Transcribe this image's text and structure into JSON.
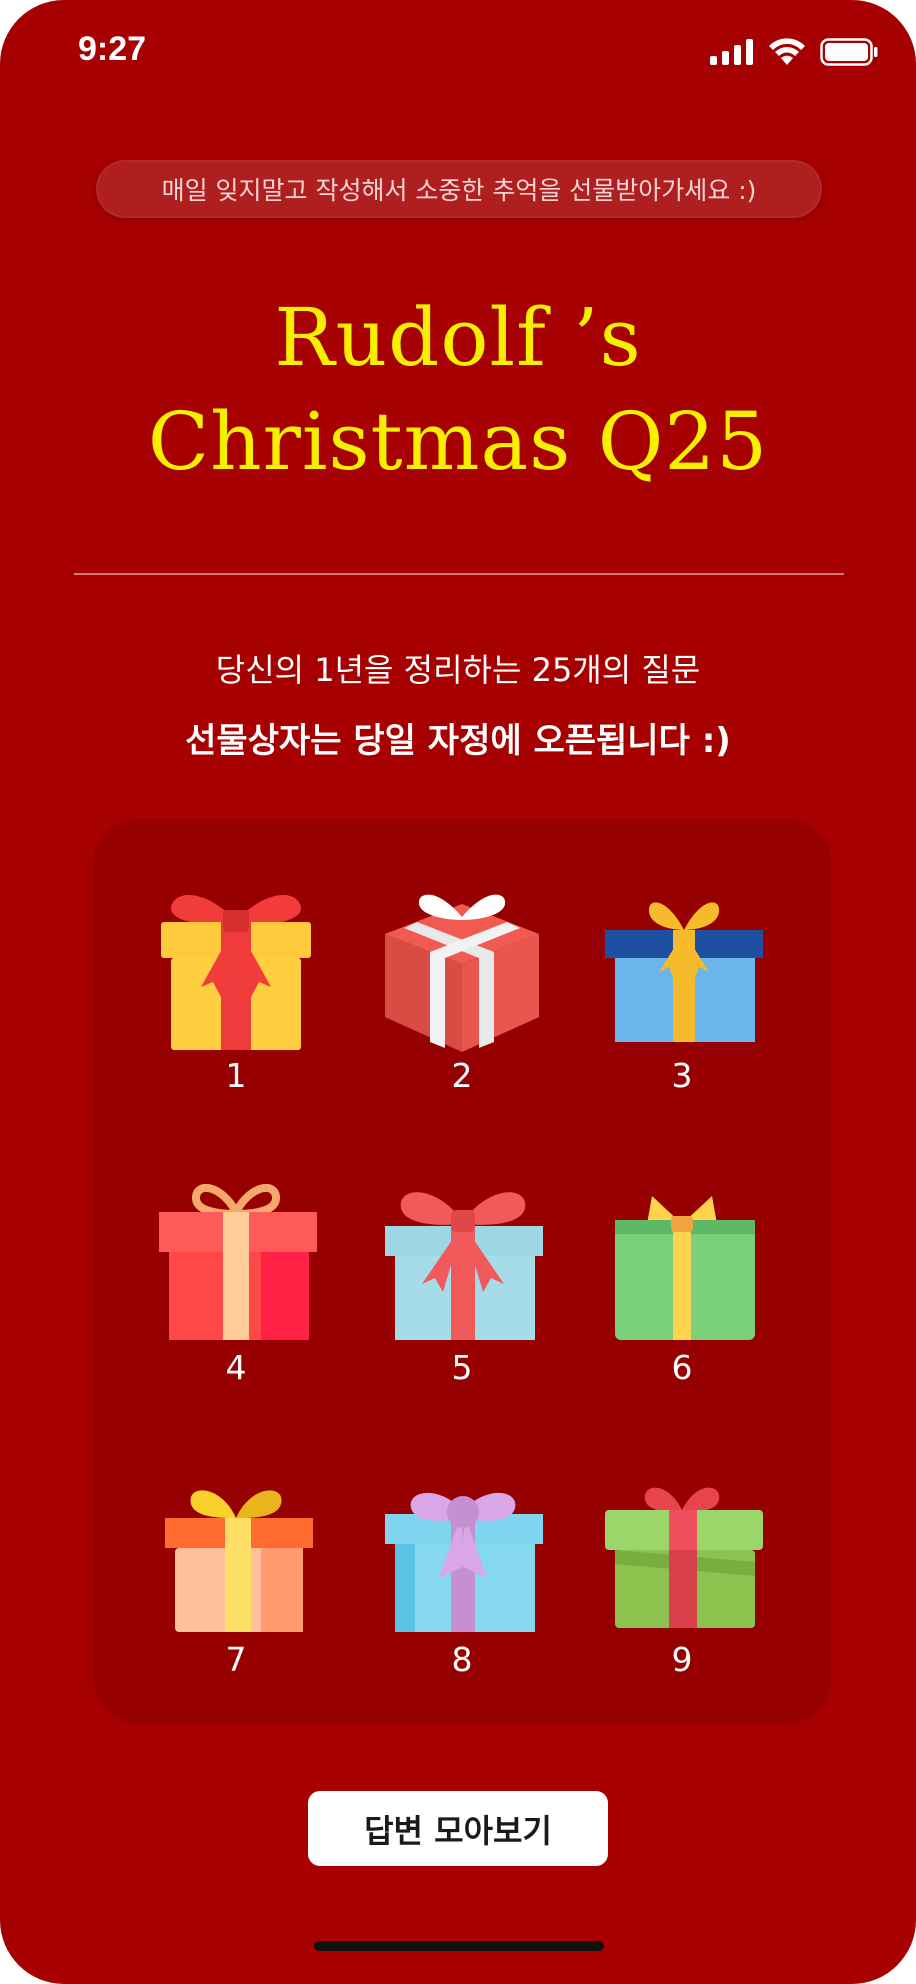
{
  "status_bar": {
    "time": "9:27"
  },
  "banner": {
    "text": "매일 잊지말고 작성해서 소중한 추억을 선물받아가세요 :)"
  },
  "title": {
    "line1": "Rudolf ’s",
    "line2": "Christmas Q25"
  },
  "intro": {
    "subtitle": "당신의 1년을 정리하는 25개의 질문",
    "notice": "선물상자는 당일 자정에 오픈됩니다 :)"
  },
  "gifts": [
    {
      "number": "1",
      "icon": "gift-box-icon"
    },
    {
      "number": "2",
      "icon": "gift-box-icon"
    },
    {
      "number": "3",
      "icon": "gift-box-icon"
    },
    {
      "number": "4",
      "icon": "gift-box-icon"
    },
    {
      "number": "5",
      "icon": "gift-box-icon"
    },
    {
      "number": "6",
      "icon": "gift-box-icon"
    },
    {
      "number": "7",
      "icon": "gift-box-icon"
    },
    {
      "number": "8",
      "icon": "gift-box-icon"
    },
    {
      "number": "9",
      "icon": "gift-box-icon"
    }
  ],
  "actions": {
    "view_answers_label": "답변 모아보기"
  },
  "colors": {
    "background": "#a60000",
    "card": "#960000",
    "title": "#f7ef00",
    "button": "#ffffff"
  }
}
